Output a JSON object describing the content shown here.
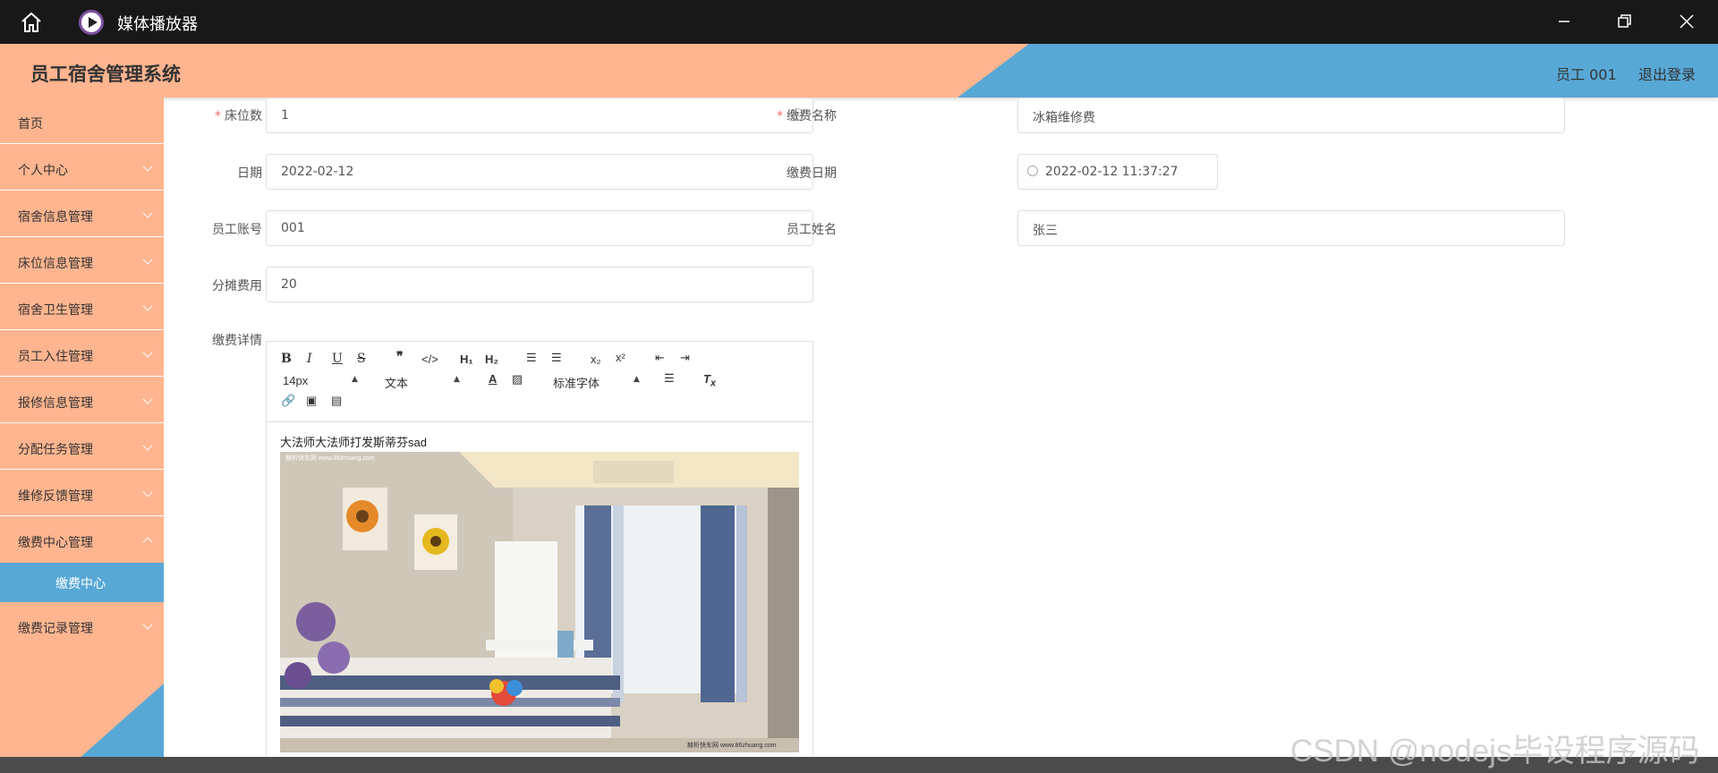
{
  "titlebar": {
    "app_title": "媒体播放器"
  },
  "header": {
    "system_title": "员工宿舍管理系统",
    "user": "员工 001",
    "logout": "退出登录"
  },
  "sidebar": {
    "items": [
      {
        "label": "首页"
      },
      {
        "label": "个人中心"
      },
      {
        "label": "宿舍信息管理"
      },
      {
        "label": "床位信息管理"
      },
      {
        "label": "宿舍卫生管理"
      },
      {
        "label": "员工入住管理"
      },
      {
        "label": "报修信息管理"
      },
      {
        "label": "分配任务管理"
      },
      {
        "label": "维修反馈管理"
      },
      {
        "label": "缴费中心管理"
      }
    ],
    "active_sub": "缴费中心",
    "last_item": "缴费记录管理"
  },
  "form": {
    "beds_label": "床位数",
    "beds_value": "1",
    "fee_name_label": "缴费名称",
    "fee_name_value": "冰箱维修费",
    "date_label": "日期",
    "date_value": "2022-02-12",
    "pay_date_label": "缴费日期",
    "pay_date_value": "2022-02-12 11:37:27",
    "account_label": "员工账号",
    "account_value": "001",
    "name_label": "员工姓名",
    "name_value": "张三",
    "share_label": "分摊费用",
    "share_value": "20",
    "detail_label": "缴费详情"
  },
  "editor": {
    "font_size": "14px",
    "block_format": "文本",
    "font_family": "标准字体",
    "content_text": "大法师大法师打发斯蒂芬sad",
    "image_watermark_top": "赫析快车网 www.86zhuang.com",
    "image_watermark_bottom": "赫析快车网 www.86zhuang.com"
  },
  "watermark": "CSDN @nodejs毕设程序源码"
}
